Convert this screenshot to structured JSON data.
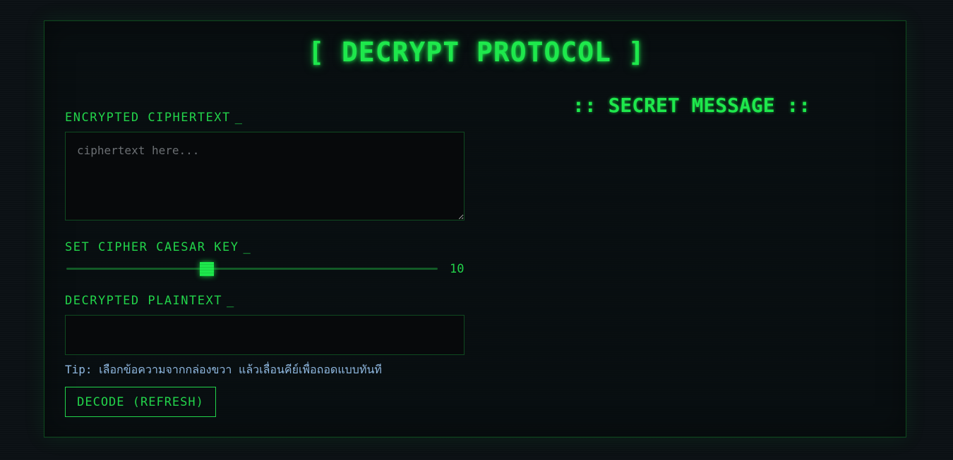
{
  "header": {
    "title": "[ DECRYPT PROTOCOL ]"
  },
  "left_panel": {
    "ciphertext_label": "ENCRYPTED CIPHERTEXT",
    "ciphertext_placeholder": "ciphertext here...",
    "ciphertext_value": "",
    "key_label": "SET CIPHER CAESAR KEY",
    "key_value": "10",
    "key_level": 10,
    "plaintext_label": "DECRYPTED PLAINTEXT",
    "plaintext_value": "",
    "tip": "Tip: เลือกข้อความจากกล่องขวา แล้วเลื่อนคีย์เพื่อถอดแบบทันที",
    "decode_button_label": "DECODE (REFRESH)",
    "cursor_char": "_"
  },
  "right_panel": {
    "heading": ":: SECRET MESSAGE ::"
  },
  "colors": {
    "accent": "#1ee84c",
    "label": "#22d34a",
    "tip": "#8fb8e0",
    "background": "#0a0f13",
    "border": "#0f4a20"
  }
}
